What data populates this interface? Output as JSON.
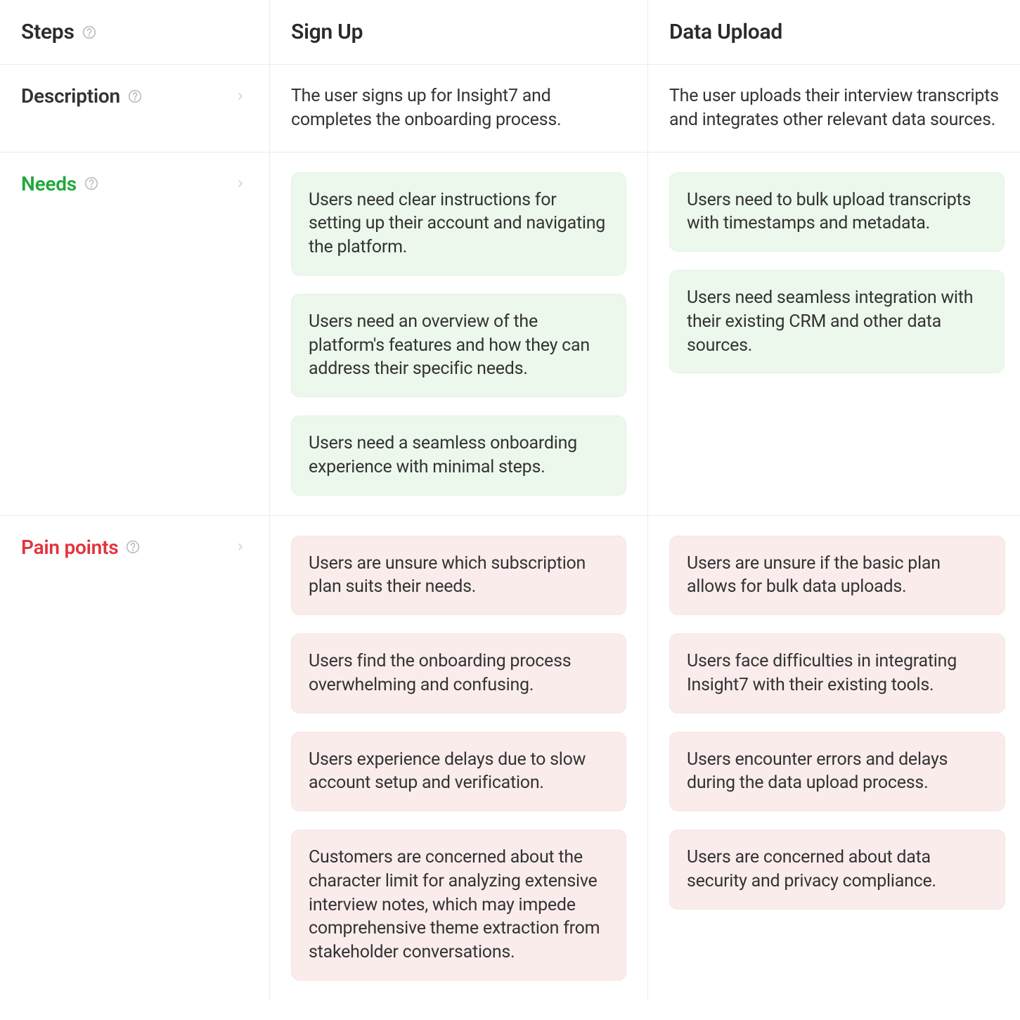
{
  "headers": {
    "steps": "Steps",
    "description": "Description",
    "needs": "Needs",
    "pain_points": "Pain points"
  },
  "columns": [
    {
      "title": "Sign Up",
      "description": "The user signs up for Insight7 and completes the onboarding process.",
      "needs": [
        "Users need clear instructions for setting up their account and navigating the platform.",
        "Users need an overview of the platform's features and how they can address their specific needs.",
        "Users need a seamless onboarding experience with minimal steps."
      ],
      "pain_points": [
        "Users are unsure which subscription plan suits their needs.",
        "Users find the onboarding process overwhelming and confusing.",
        "Users experience delays due to slow account setup and verification.",
        "Customers are concerned about the character limit for analyzing extensive interview notes, which may impede comprehensive theme extraction from stakeholder conversations."
      ]
    },
    {
      "title": "Data Upload",
      "description": "The user uploads their interview transcripts and integrates other relevant data sources.",
      "needs": [
        "Users need to bulk upload transcripts with timestamps and metadata.",
        "Users need seamless integration with their existing CRM and other data sources."
      ],
      "pain_points": [
        "Users are unsure if the basic plan allows for bulk data uploads.",
        "Users face difficulties in integrating Insight7 with their existing tools.",
        "Users encounter errors and delays during the data upload process.",
        "Users are concerned about data security and privacy compliance."
      ]
    }
  ]
}
